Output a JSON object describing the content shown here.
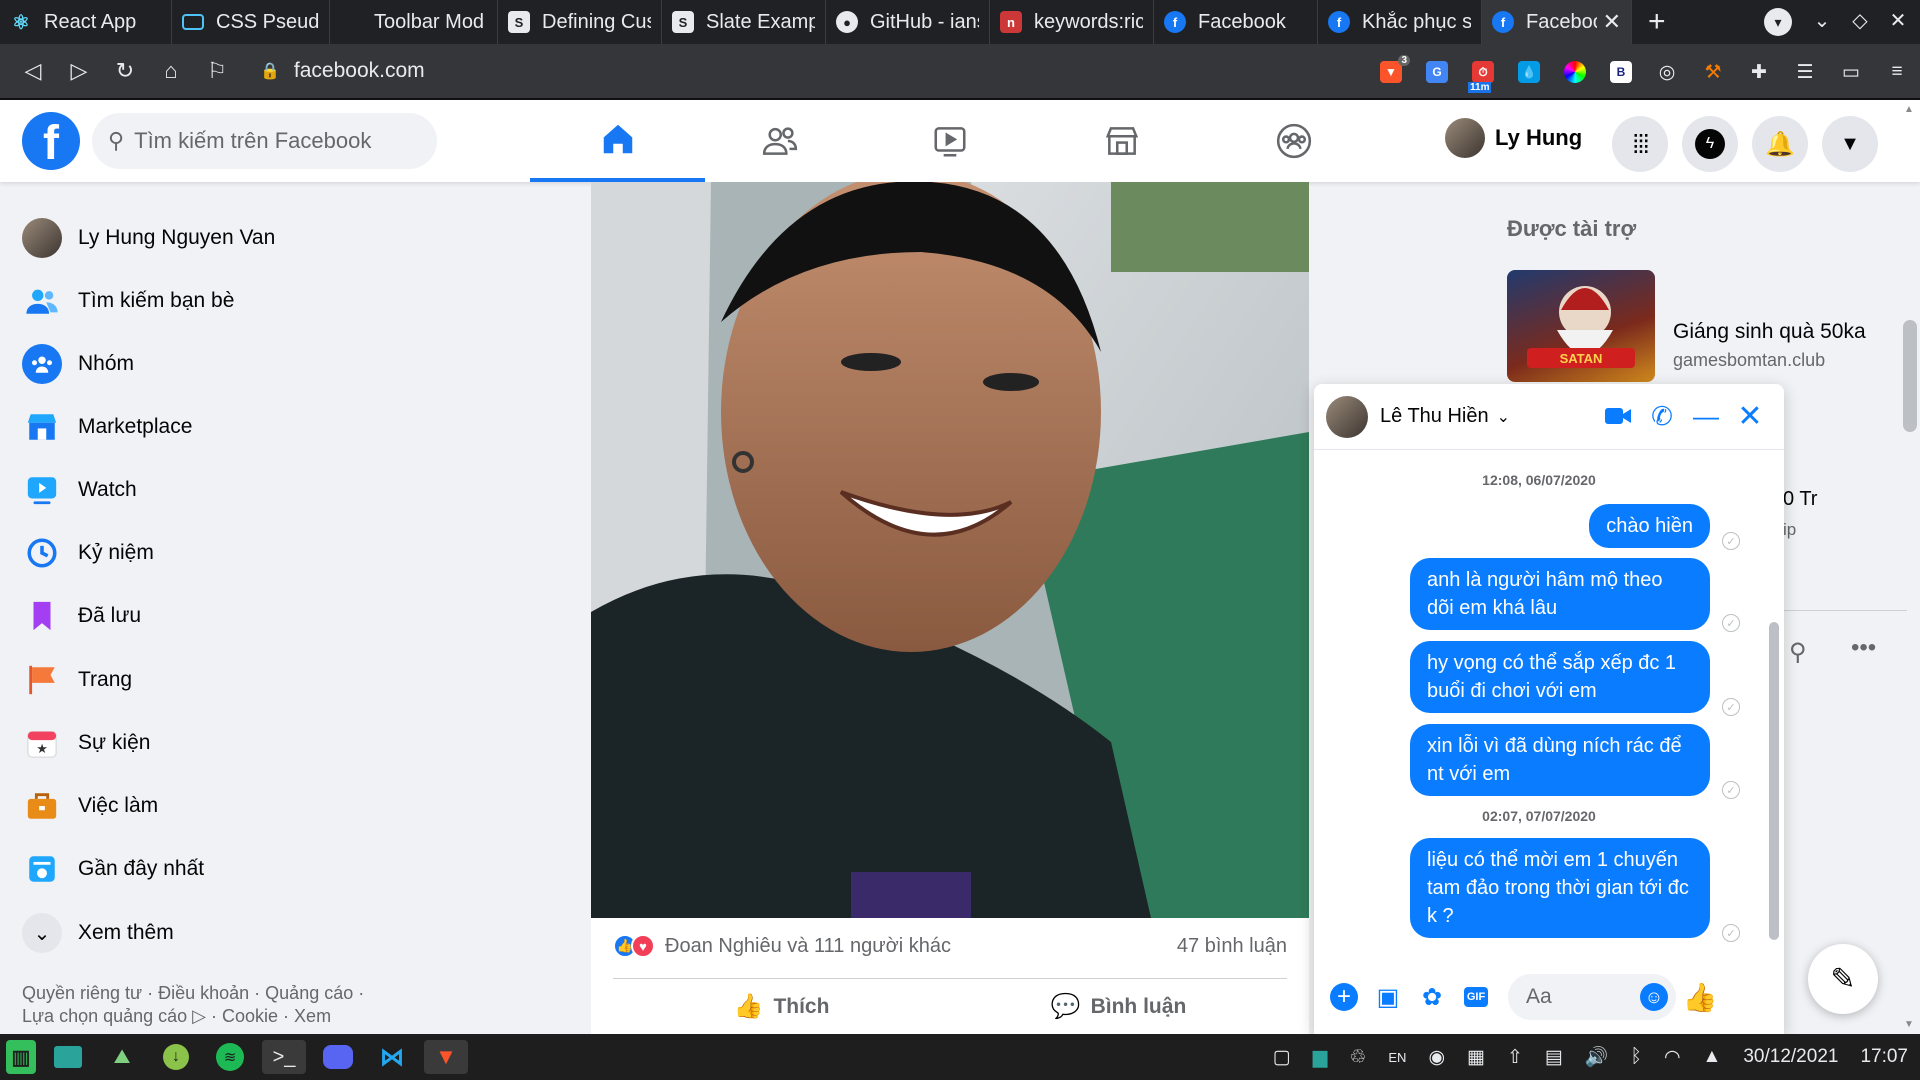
{
  "browser": {
    "tabs": [
      {
        "title": "React App",
        "icon": "react-icon"
      },
      {
        "title": "CSS Pseudo",
        "icon": "monitor-icon"
      },
      {
        "title": "Toolbar Mod",
        "icon": "blank-page-icon"
      },
      {
        "title": "Defining Cus",
        "icon": "slate-icon",
        "glyph": "S"
      },
      {
        "title": "Slate Examp",
        "icon": "slate-icon",
        "glyph": "S"
      },
      {
        "title": "GitHub - ians",
        "icon": "github-icon"
      },
      {
        "title": "keywords:ric",
        "icon": "npm-icon"
      },
      {
        "title": "Facebook",
        "icon": "facebook-icon",
        "glyph": "f"
      },
      {
        "title": "Khắc phục s",
        "icon": "facebook-icon",
        "glyph": "f"
      },
      {
        "title": "Faceboo",
        "icon": "facebook-icon",
        "glyph": "f",
        "active": true
      }
    ],
    "url": "facebook.com",
    "brave_badge": "3",
    "timer_badge": "11m"
  },
  "fb": {
    "search_placeholder": "Tìm kiếm trên Facebook",
    "profile_name": "Ly Hung"
  },
  "leftnav": {
    "items": [
      {
        "label": "Ly Hung Nguyen Van",
        "icon": "profile-avatar"
      },
      {
        "label": "Tìm kiếm bạn bè",
        "icon": "friends-icon"
      },
      {
        "label": "Nhóm",
        "icon": "groups-icon"
      },
      {
        "label": "Marketplace",
        "icon": "marketplace-icon"
      },
      {
        "label": "Watch",
        "icon": "watch-icon"
      },
      {
        "label": "Kỷ niệm",
        "icon": "memories-icon"
      },
      {
        "label": "Đã lưu",
        "icon": "saved-icon"
      },
      {
        "label": "Trang",
        "icon": "pages-flag-icon"
      },
      {
        "label": "Sự kiện",
        "icon": "events-icon"
      },
      {
        "label": "Việc làm",
        "icon": "jobs-icon"
      },
      {
        "label": "Gần đây nhất",
        "icon": "recent-icon"
      },
      {
        "label": "Xem thêm",
        "icon": "chevron-down-icon"
      }
    ],
    "footer_line1": "Quyền riêng tư · Điều khoản · Quảng cáo ·",
    "footer_line2": "Lựa chọn quảng cáo ▷ · Cookie · Xem"
  },
  "post": {
    "reactions_text": "Đoan Nghiêu và 111 người khác",
    "comments_count": "47 bình luận",
    "like_label": "Thích",
    "comment_label": "Bình luận"
  },
  "sponsored": {
    "heading": "Được tài trợ",
    "ad_title": "Giáng sinh quà 50ka",
    "ad_domain": "gamesbomtan.club",
    "ad_image_text": "SATAN",
    "partial_text": "0 Tr",
    "partial_sub": "ip"
  },
  "chat": {
    "contact_name": "Lê Thu Hiền",
    "timestamps": [
      "12:08, 06/07/2020",
      "02:07, 07/07/2020"
    ],
    "messages": [
      "chào hiền",
      "anh là người hâm mộ theo dõi em khá lâu",
      "hy vọng có thể sắp xếp đc 1 buổi đi chơi với em",
      "xin lỗi vì đã dùng ních rác để nt với em",
      "liệu có thể mời em 1 chuyến tam đảo trong thời gian tới đc k ?"
    ],
    "input_placeholder": "Aa"
  },
  "taskbar": {
    "lang": "EN",
    "date": "30/12/2021",
    "time": "17:07"
  },
  "colors": {
    "facebook_blue": "#1877f2",
    "messenger_blue": "#0a7cff",
    "browser_dark": "#202124"
  }
}
